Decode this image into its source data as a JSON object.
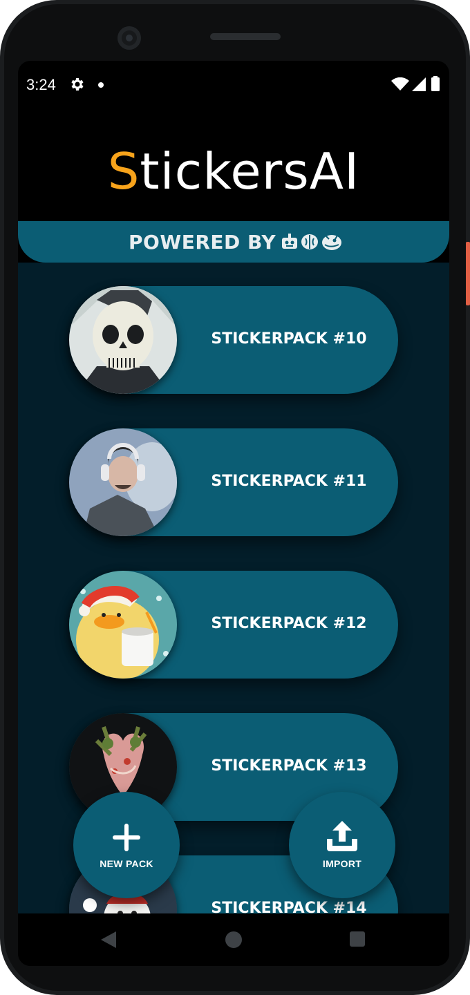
{
  "status_bar": {
    "time": "3:24"
  },
  "header": {
    "logo_first_letter": "S",
    "logo_rest": "tickersAI"
  },
  "banner": {
    "label": "POWERED BY"
  },
  "packs": [
    {
      "label": "STICKERPACK #10"
    },
    {
      "label": "STICKERPACK #11"
    },
    {
      "label": "STICKERPACK #12"
    },
    {
      "label": "STICKERPACK #13"
    },
    {
      "label": "STICKERPACK #14"
    }
  ],
  "actions": {
    "new_pack_label": "NEW PACK",
    "import_label": "IMPORT"
  },
  "icons": [
    "gear-icon",
    "wifi-icon",
    "signal-icon",
    "battery-icon",
    "robot-icon",
    "brain-icon",
    "dragon-icon",
    "plus-icon",
    "upload-icon",
    "back-icon",
    "home-icon",
    "recents-icon"
  ],
  "colors": {
    "accent": "#f7a31b",
    "card": "#0b5d74",
    "background": "#031e2a",
    "header": "#000000"
  }
}
